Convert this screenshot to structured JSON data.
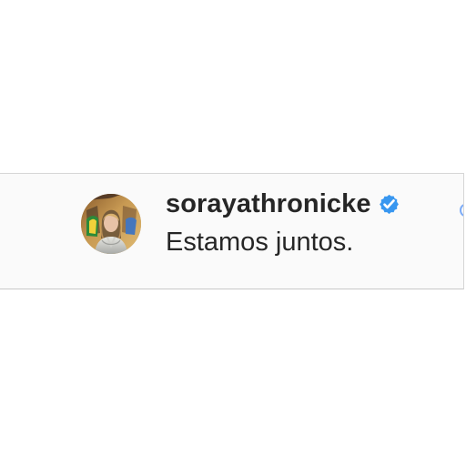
{
  "comment": {
    "username": "sorayathronicke",
    "verified_icon": "verified-badge-icon",
    "text": "Estamos juntos."
  },
  "avatar": {
    "icon": "profile-photo"
  },
  "colors": {
    "background": "#ffffff",
    "card_background": "#fafafa",
    "text": "#262626",
    "verified_blue": "#3897f0"
  }
}
